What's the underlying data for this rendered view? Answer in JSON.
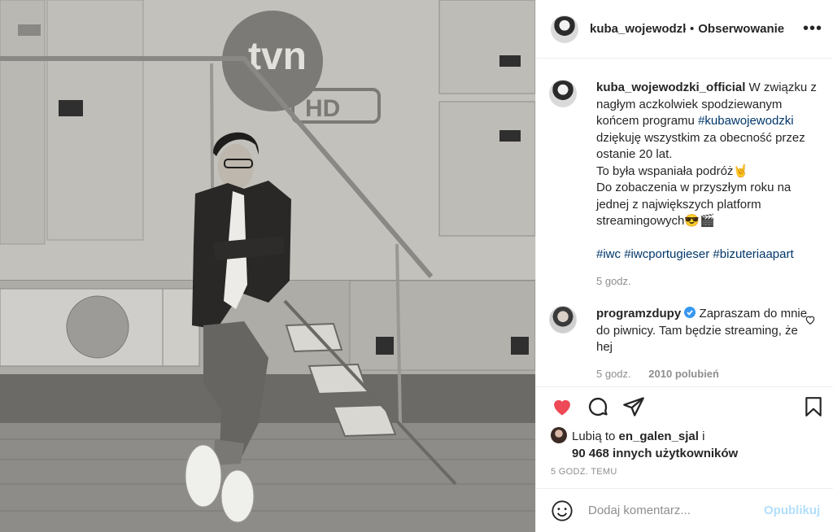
{
  "photo": {
    "alt_logo": "tvn",
    "alt_logo_sub": "HD"
  },
  "header": {
    "username": "kuba_wojewodzki_official",
    "separator": "•",
    "follow_label": "Obserwowanie",
    "more_label": "•••"
  },
  "caption": {
    "username": "kuba_wojewodzki_official",
    "text_1": " W związku z nagłym aczkolwiek spodziewanym końcem programu ",
    "hashtag_1": "#kubawojewodzki",
    "text_2": " dziękuję wszystkim za obecność przez ostanie 20 lat.",
    "line_3": "To była wspaniała podróż🤘",
    "line_4": "Do zobaczenia w przyszłym roku na jednej z największych platform streamingowych😎🎬",
    "hashtags": [
      "#iwc",
      "#iwcportugieser",
      "#bizuteriaapart"
    ],
    "time": "5 godz."
  },
  "comment": {
    "username": "programzdupy",
    "verified": true,
    "text": " Zapraszam do mnie do piwnicy. Tam będzie streaming, że hej",
    "time": "5 godz.",
    "likes": "2010 polubień"
  },
  "actions": {
    "liked_prefix": "Lubią to ",
    "liked_user": "en_galen_sjal",
    "liked_and": " i",
    "liked_count": "90 468 innych użytkowników",
    "timestamp": "5 GODZ. TEMU"
  },
  "add_comment": {
    "placeholder": "Dodaj komentarz...",
    "post_label": "Opublikuj"
  },
  "colors": {
    "like_red": "#ed4956",
    "link_blue": "#00376b",
    "post_disabled": "#b2dffc",
    "verified_blue": "#3897f0"
  }
}
